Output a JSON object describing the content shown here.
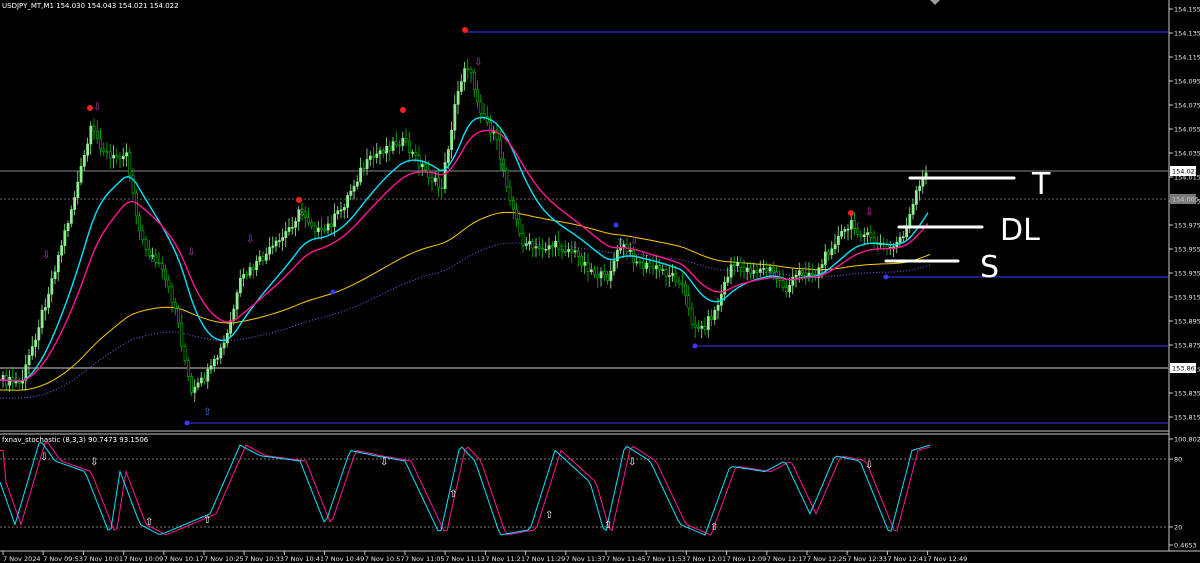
{
  "window": {
    "symbol_info": "USDJPY_MT,M1  154.030 154.043 154.021 154.022",
    "indicator_info": "fxnav_stochastic (8,3,3) 90.7473 93.1506"
  },
  "price_axis": {
    "labels": [
      "154.155",
      "154.135",
      "154.115",
      "154.095",
      "154.075",
      "154.055",
      "154.035",
      "154.015",
      "153.995",
      "153.975",
      "153.955",
      "153.935",
      "153.915",
      "153.895",
      "153.875",
      "153.855",
      "153.835",
      "153.815"
    ],
    "current_price_tag": "154.022",
    "lower_tag": "154.005",
    "level_tag": "153.863"
  },
  "stoch_axis": {
    "labels": [
      "100.8022",
      "80",
      "20",
      "0.4653"
    ]
  },
  "time_axis": {
    "labels": [
      "7 Nov 2024",
      "7 Nov 09:53",
      "7 Nov 10:01",
      "7 Nov 10:09",
      "7 Nov 10:17",
      "7 Nov 10:25",
      "7 Nov 10:33",
      "7 Nov 10:41",
      "7 Nov 10:49",
      "7 Nov 10:57",
      "7 Nov 11:05",
      "7 Nov 11:13",
      "7 Nov 11:21",
      "7 Nov 11:29",
      "7 Nov 11:37",
      "7 Nov 11:45",
      "7 Nov 11:53",
      "7 Nov 12:01",
      "7 Nov 12:09",
      "7 Nov 12:17",
      "7 Nov 12:25",
      "7 Nov 12:33",
      "7 Nov 12:41",
      "7 Nov 12:49"
    ]
  },
  "annotations": {
    "target": "T",
    "dl": "DL",
    "stop": "S"
  },
  "colors": {
    "bull": "#90ee90",
    "bear": "#00c000",
    "fast_ma": "#00e5ff",
    "slow_ma": "#ff1493",
    "cloud": "#ffcc00",
    "level": "#3a3aff",
    "stoch_k": "#00e5ff",
    "stoch_d": "#ff1493"
  }
}
